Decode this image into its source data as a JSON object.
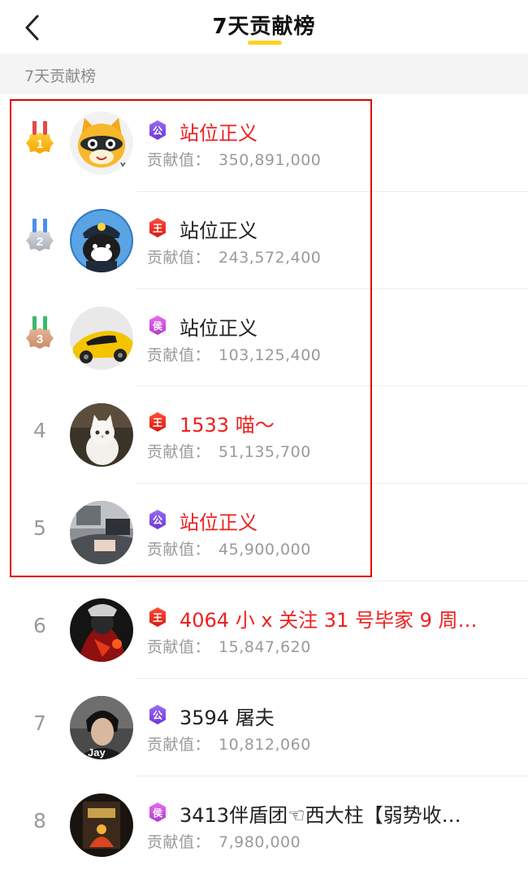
{
  "header": {
    "title": "7天贡献榜",
    "accent_color": "#ffd21e"
  },
  "section": {
    "title": "7天贡献榜"
  },
  "colors": {
    "highlight_red": "#ef1f1f",
    "gray_text": "#9a9a9a"
  },
  "rows": [
    {
      "rank": "1",
      "medal": "gold-medal",
      "badge": "公",
      "badge_type": "purple",
      "name": "站位正义",
      "name_red": true,
      "score_label": "贡献值：",
      "score": "350,891,000"
    },
    {
      "rank": "2",
      "medal": "silver-medal",
      "badge": "王",
      "badge_type": "red",
      "name": "站位正义",
      "name_red": false,
      "score_label": "贡献值：",
      "score": "243,572,400"
    },
    {
      "rank": "3",
      "medal": "bronze-medal",
      "badge": "侯",
      "badge_type": "pink",
      "name": "站位正义",
      "name_red": false,
      "score_label": "贡献值：",
      "score": "103,125,400"
    },
    {
      "rank": "4",
      "medal": null,
      "badge": "王",
      "badge_type": "red",
      "name": "1533 喵～",
      "name_red": true,
      "score_label": "贡献值：",
      "score": "51,135,700"
    },
    {
      "rank": "5",
      "medal": null,
      "badge": "公",
      "badge_type": "purple",
      "name": "站位正义",
      "name_red": true,
      "score_label": "贡献值：",
      "score": "45,900,000"
    },
    {
      "rank": "6",
      "medal": null,
      "badge": "王",
      "badge_type": "red",
      "name": "4064 小 x 关注 31 号毕家 9 周…",
      "name_red": true,
      "score_label": "贡献值：",
      "score": "15,847,620"
    },
    {
      "rank": "7",
      "medal": null,
      "badge": "公",
      "badge_type": "purple",
      "name": "3594 屠夫",
      "name_red": false,
      "score_label": "贡献值：",
      "score": "10,812,060"
    },
    {
      "rank": "8",
      "medal": null,
      "badge": "侯",
      "badge_type": "pink",
      "name": "3413伴盾团☜西大柱【弱势收…",
      "name_red": false,
      "score_label": "贡献值：",
      "score": "7,980,000"
    }
  ]
}
